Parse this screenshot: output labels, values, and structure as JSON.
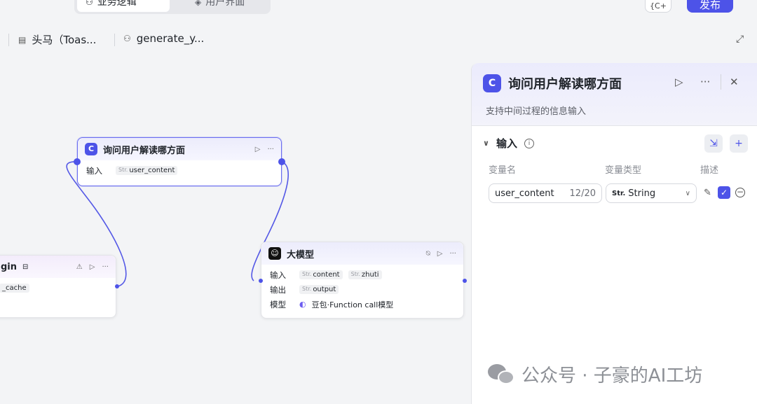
{
  "topbar": {
    "tabs": [
      {
        "label": "业务逻辑",
        "icon": "workflow-icon"
      },
      {
        "label": "用户界面",
        "icon": "ui-icon"
      }
    ],
    "icon_button_label": "{C+",
    "publish_label": "发布",
    "more_label": "···"
  },
  "breadcrumbs": [
    {
      "label": "头马（Toas...",
      "icon": "document-icon"
    },
    {
      "label": "generate_y...",
      "icon": "workflow-icon"
    }
  ],
  "canvas": {
    "nodes": {
      "ask": {
        "title": "询问用户解读哪方面",
        "logo": "C",
        "input_label": "输入",
        "input_tag_type": "Str.",
        "input_tag_name": "user_content",
        "actions": [
          "▷",
          "···"
        ]
      },
      "begin": {
        "title": "gin",
        "tag_name": "_cache",
        "actions": [
          "⚠",
          "▷",
          "···"
        ]
      },
      "llm": {
        "title": "大模型",
        "input_label": "输入",
        "inputs": [
          {
            "type": "Str.",
            "name": "content"
          },
          {
            "type": "Str.",
            "name": "zhuti"
          }
        ],
        "output_label": "输出",
        "output": {
          "type": "Str.",
          "name": "output"
        },
        "model_label": "模型",
        "model_value": "豆包·Function call模型",
        "actions": [
          "▷",
          "···"
        ]
      }
    },
    "colors": {
      "accent": "#4d53e8",
      "edge": "#5458e6"
    }
  },
  "panel": {
    "title": "询问用户解读哪方面",
    "logo": "C",
    "description": "支持中间过程的信息输入",
    "section_title": "输入",
    "columns": {
      "name": "变量名",
      "type": "变量类型",
      "desc": "描述"
    },
    "variable": {
      "name": "user_content",
      "count": "12/20",
      "type_prefix": "Str.",
      "type": "String",
      "required": true
    }
  },
  "watermark": "公众号 · 子豪的AI工坊"
}
